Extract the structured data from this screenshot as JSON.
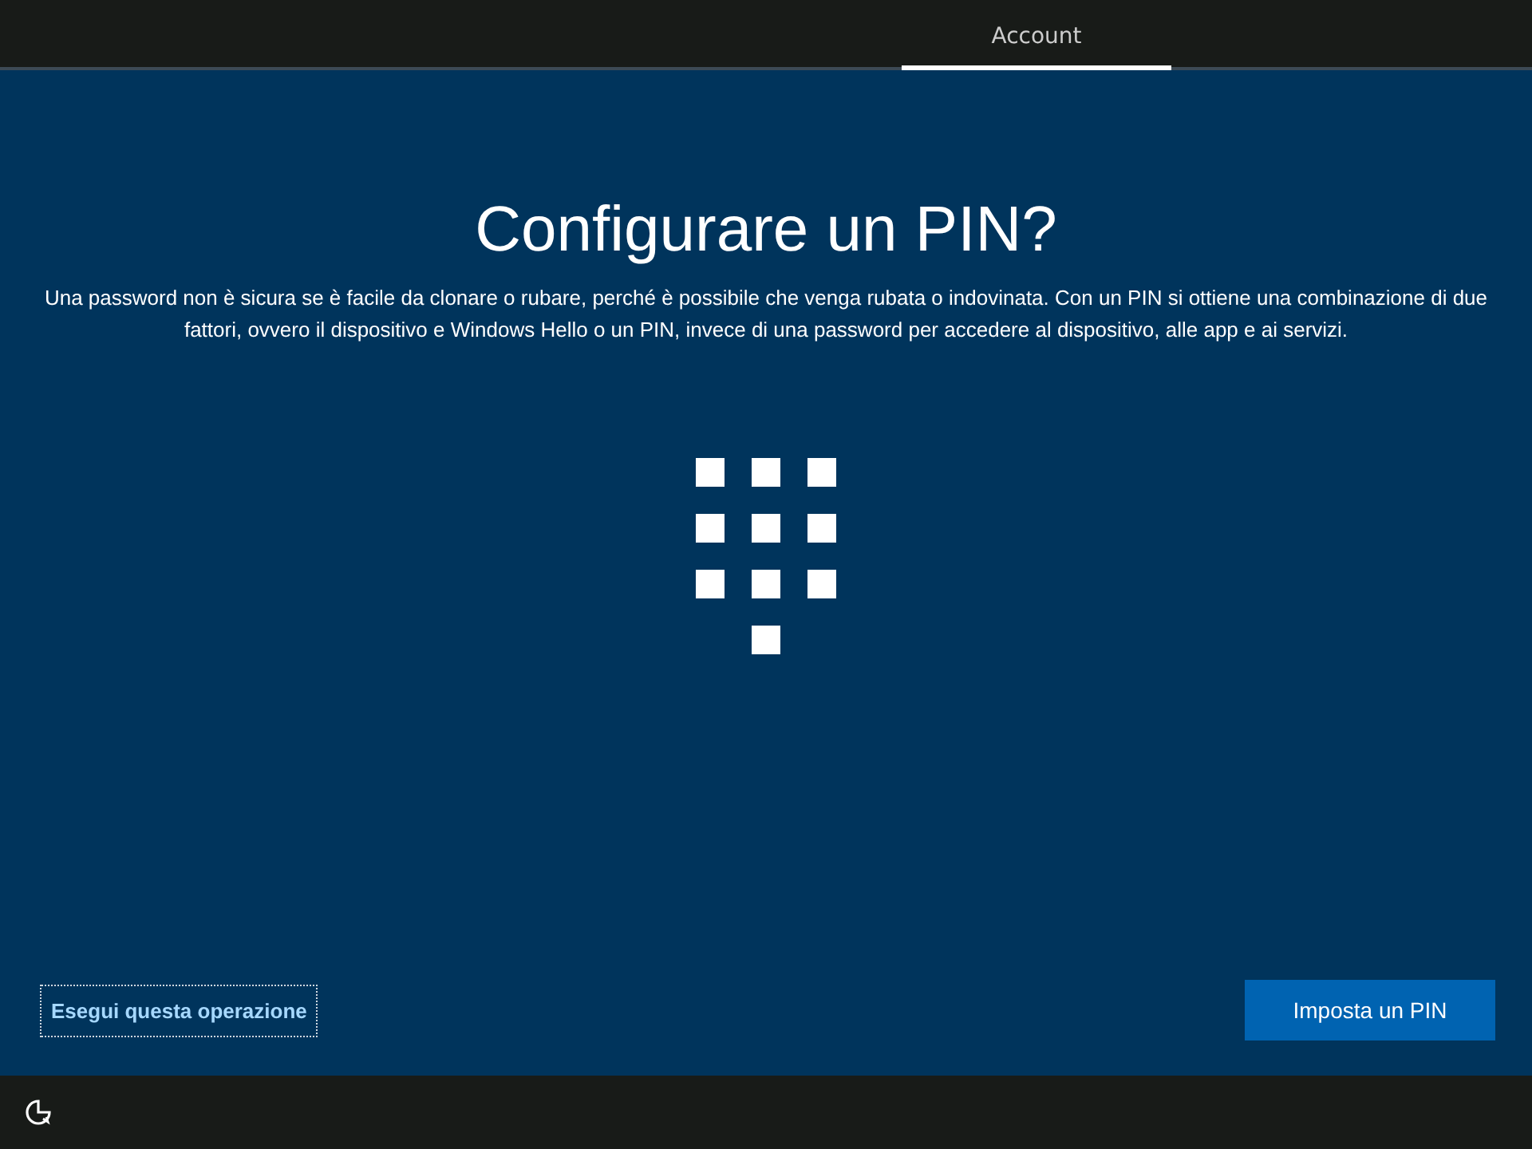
{
  "tabs": [
    {
      "label": "Account",
      "selected": true
    }
  ],
  "title": "Configurare un PIN?",
  "description": "Una password non è sicura se è facile da clonare o rubare, perché è possibile che venga rubata o indovinata. Con un PIN si ottiene una combinazione di due fattori, ovvero il dispositivo e Windows Hello o un PIN, invece di una password per accedere al dispositivo, alle app e ai servizi.",
  "skip_link": "Esegui questa operazione",
  "primary_button": "Imposta un PIN"
}
